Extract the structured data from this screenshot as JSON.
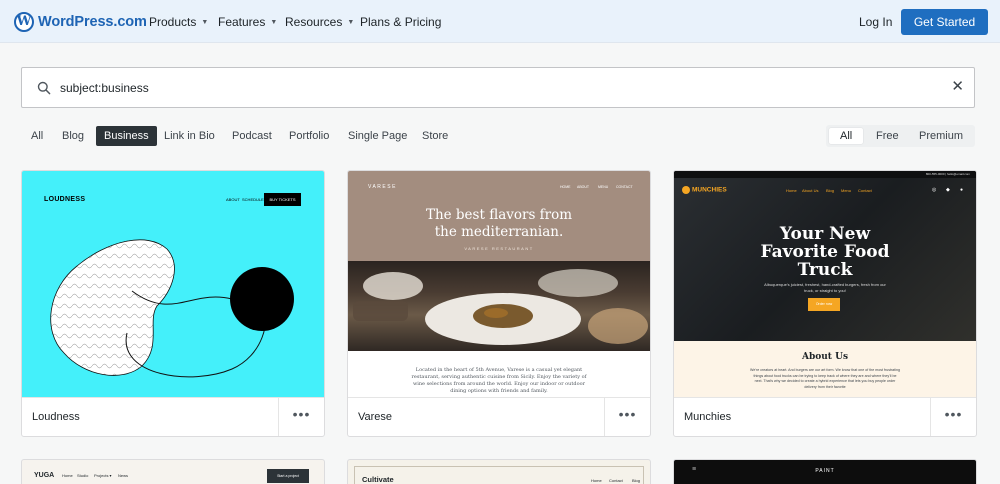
{
  "nav": {
    "brand": "WordPress.com",
    "brand_glyph": "W",
    "items": [
      {
        "label": "Products",
        "dropdown": true
      },
      {
        "label": "Features",
        "dropdown": true
      },
      {
        "label": "Resources",
        "dropdown": true
      },
      {
        "label": "Plans & Pricing",
        "dropdown": false
      }
    ],
    "login": "Log In",
    "cta": "Get Started"
  },
  "search": {
    "value": "subject:business",
    "icon": "search-icon",
    "clear_icon": "close-icon",
    "clear_glyph": "✕"
  },
  "categories": [
    {
      "label": "All",
      "active": false
    },
    {
      "label": "Blog",
      "active": false
    },
    {
      "label": "Business",
      "active": true
    },
    {
      "label": "Link in Bio",
      "active": false
    },
    {
      "label": "Podcast",
      "active": false
    },
    {
      "label": "Portfolio",
      "active": false
    },
    {
      "label": "Single Page",
      "active": false
    },
    {
      "label": "Store",
      "active": false
    }
  ],
  "tiers": [
    {
      "label": "All",
      "active": true
    },
    {
      "label": "Free",
      "active": false
    },
    {
      "label": "Premium",
      "active": false
    }
  ],
  "themes": [
    {
      "name": "Loudness",
      "menu_glyph": "•••",
      "preview": {
        "logo": "LOUDNESS",
        "menu": [
          "ABOUT",
          "SCHEDULE"
        ],
        "button": "BUY TICKETS",
        "background": "#44f0fa"
      }
    },
    {
      "name": "Varese",
      "menu_glyph": "•••",
      "preview": {
        "logo": "VARESE",
        "menu": [
          "HOME",
          "ABOUT",
          "MENU",
          "CONTACT"
        ],
        "headline_line1": "The best flavors from",
        "headline_line2": "the mediterranian.",
        "subheading": "VARESE RESTAURANT",
        "body": "Located in the heart of 5th Avenue, Varese is a casual yet elegant restaurant, serving authentic cuisine from Sicily. Enjoy the variety of wine selections from around the world. Enjoy our indoor or outdoor dining options with friends and family."
      }
    },
    {
      "name": "Munchies",
      "menu_glyph": "•••",
      "preview": {
        "logo": "MUNCHIES",
        "top_strip": "800-555-0000 | hello@email.com",
        "menu": [
          "Home",
          "About Us",
          "Blog",
          "Menu",
          "Contact"
        ],
        "headline_line1": "Your New",
        "headline_line2": "Favorite Food",
        "headline_line3": "Truck",
        "tagline": "Albuquerque's juiciest, freshest, hand-crafted burgers, fresh from our truck, or straight to you!",
        "button": "Order now",
        "about_title": "About Us",
        "about_text": "We're creators at heart. And burgers are our art form. We know that one of the most frustrating things about food trucks can be trying to keep track of where they are and where they'll be next. That's why we decided to create a hybrid experience that lets you buy people order delivery from their favorite",
        "accent": "#f5a623"
      }
    },
    {
      "preview": {
        "logo": "YUGA",
        "menu": [
          "Home",
          "Studio",
          "Projects ▾",
          "News"
        ],
        "button": "Start a project"
      }
    },
    {
      "preview": {
        "logo": "Cultivate",
        "menu": [
          "Home",
          "Contact",
          "Blog"
        ]
      }
    },
    {
      "preview": {
        "logo": "PAINT",
        "menu_icon": "≡"
      }
    }
  ],
  "colors": {
    "brand_blue": "#1e64b4",
    "cta_blue": "#1f6ec0",
    "active_filter": "#2c3338",
    "nav_bg": "#e9f2fb"
  }
}
